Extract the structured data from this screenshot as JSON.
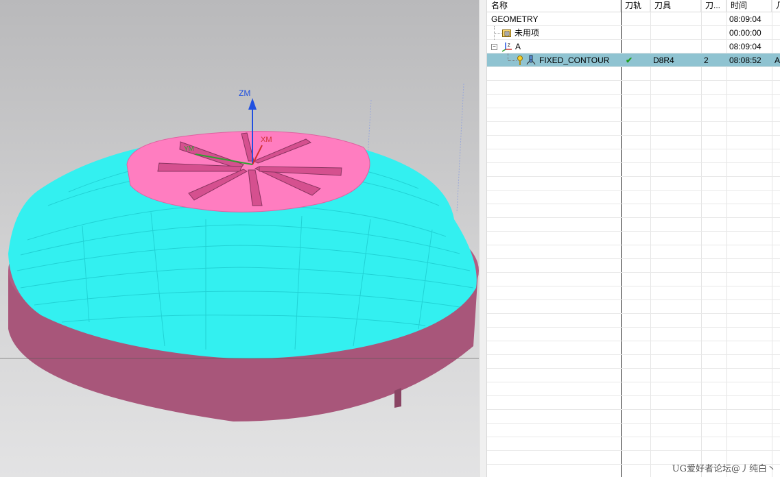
{
  "viewport": {
    "axis_labels": {
      "z": "ZM",
      "x": "XM",
      "y": "YM"
    }
  },
  "navigator": {
    "columns": [
      "名称",
      "刀轨",
      "刀具",
      "刀...",
      "时间",
      "几"
    ],
    "rows": [
      {
        "name": "GEOMETRY",
        "toolpath": "",
        "tool": "",
        "tool_num": "",
        "time": "08:09:04",
        "extra": "",
        "icon": "none"
      },
      {
        "name": "未用项",
        "toolpath": "",
        "tool": "",
        "tool_num": "",
        "time": "00:00:00",
        "extra": "",
        "icon": "unused-folder-icon"
      },
      {
        "name": "A",
        "toolpath": "",
        "tool": "",
        "tool_num": "",
        "time": "08:09:04",
        "extra": "",
        "icon": "mcs-geometry-icon"
      },
      {
        "name": "FIXED_CONTOUR",
        "toolpath": "✔",
        "tool": "D8R4",
        "tool_num": "2",
        "time": "08:08:52",
        "extra": "A",
        "icon": "fixed-contour-operation-icon"
      }
    ],
    "selected_row": 3
  },
  "watermark": "UG爱好者论坛@丿纯白丶",
  "colors": {
    "part_body": "#a8567a",
    "toolpath": "#33f0f0",
    "top_face": "#ff7dc0",
    "selection": "#8fc3d1",
    "check": "#1e9e1e"
  }
}
